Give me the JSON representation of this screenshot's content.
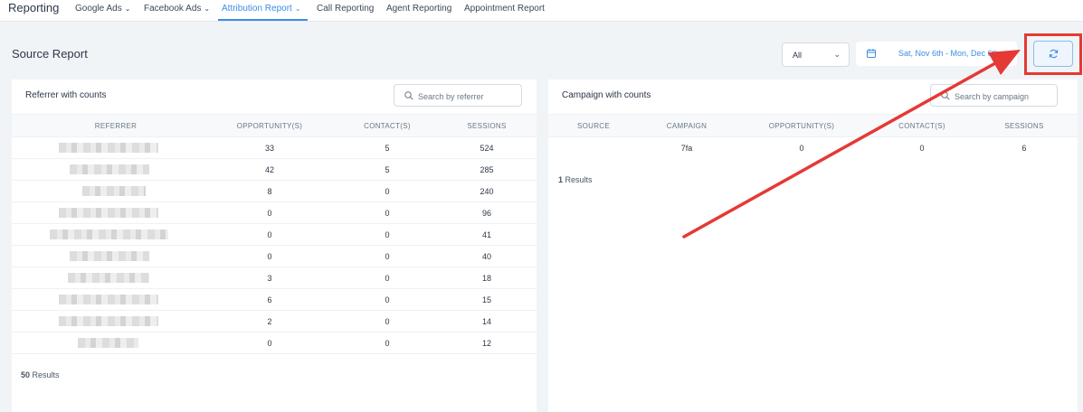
{
  "nav": {
    "brand": "Reporting",
    "items": [
      {
        "label": "Google Ads",
        "has_dropdown": true,
        "active": false
      },
      {
        "label": "Facebook Ads",
        "has_dropdown": true,
        "active": false
      },
      {
        "label": "Attribution Report",
        "has_dropdown": true,
        "active": true
      },
      {
        "label": "Call Reporting",
        "has_dropdown": false,
        "active": false
      },
      {
        "label": "Agent Reporting",
        "has_dropdown": false,
        "active": false
      },
      {
        "label": "Appointment Report",
        "has_dropdown": false,
        "active": false
      }
    ],
    "chevron": "⌄"
  },
  "page": {
    "title": "Source Report",
    "filter_select": "All",
    "filter_chevron": "⌄",
    "date_range": "Sat, Nov 6th - Mon, Dec 6th",
    "calendar_icon": "calendar-icon",
    "refresh_icon": "refresh-icon"
  },
  "referrer_panel": {
    "title": "Referrer with counts",
    "search_placeholder": "Search by referrer",
    "columns": [
      "REFERRER",
      "OPPORTUNITY(S)",
      "CONTACT(S)",
      "SESSIONS"
    ],
    "rows": [
      {
        "opportunities": "33",
        "contacts": "5",
        "sessions": "524"
      },
      {
        "opportunities": "42",
        "contacts": "5",
        "sessions": "285"
      },
      {
        "opportunities": "8",
        "contacts": "0",
        "sessions": "240"
      },
      {
        "opportunities": "0",
        "contacts": "0",
        "sessions": "96"
      },
      {
        "opportunities": "0",
        "contacts": "0",
        "sessions": "41"
      },
      {
        "opportunities": "0",
        "contacts": "0",
        "sessions": "40"
      },
      {
        "opportunities": "3",
        "contacts": "0",
        "sessions": "18"
      },
      {
        "opportunities": "6",
        "contacts": "0",
        "sessions": "15"
      },
      {
        "opportunities": "2",
        "contacts": "0",
        "sessions": "14"
      },
      {
        "opportunities": "0",
        "contacts": "0",
        "sessions": "12"
      }
    ],
    "results_count": "50",
    "results_label": "Results"
  },
  "campaign_panel": {
    "title": "Campaign with counts",
    "search_placeholder": "Search by campaign",
    "columns": [
      "SOURCE",
      "CAMPAIGN",
      "OPPORTUNITY(S)",
      "CONTACT(S)",
      "SESSIONS"
    ],
    "rows": [
      {
        "source": "",
        "campaign": "7fa",
        "opportunities": "0",
        "contacts": "0",
        "sessions": "6"
      }
    ],
    "results_count": "1",
    "results_label": "Results"
  },
  "colors": {
    "accent": "#3a8ee6",
    "annotation": "#e53935"
  }
}
